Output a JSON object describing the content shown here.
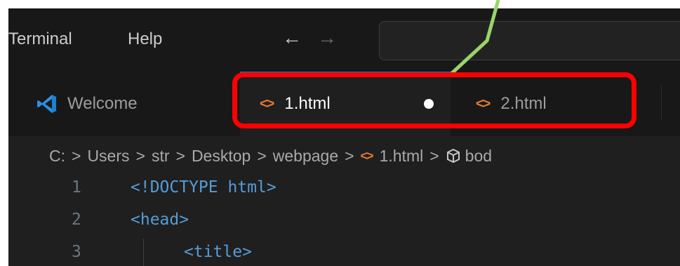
{
  "menubar": {
    "items": [
      {
        "label": "Terminal"
      },
      {
        "label": "Help"
      }
    ],
    "back_icon": "arrow-left-icon",
    "forward_icon": "arrow-right-icon",
    "back_glyph": "←",
    "forward_glyph": "→"
  },
  "tabs": [
    {
      "label": "Welcome",
      "icon": "vscode-logo-icon",
      "active": false
    },
    {
      "label": "1.html",
      "icon": "html-file-icon",
      "active": true,
      "dirty": true
    },
    {
      "label": "2.html",
      "icon": "html-file-icon",
      "active": false
    }
  ],
  "breadcrumb": {
    "items": [
      "C:",
      "Users",
      "str",
      "Desktop",
      "webpage",
      "1.html",
      "bod"
    ],
    "separator": ">"
  },
  "editor": {
    "lines": [
      {
        "number": "1",
        "text": "<!DOCTYPE html>"
      },
      {
        "number": "2",
        "text": "<head>"
      },
      {
        "number": "3",
        "text": "<title>"
      }
    ]
  },
  "colors": {
    "accent": "#0078d4",
    "annotation_box": "#ff0000",
    "annotation_line": "#9ad36b",
    "html_icon": "#e37933"
  }
}
